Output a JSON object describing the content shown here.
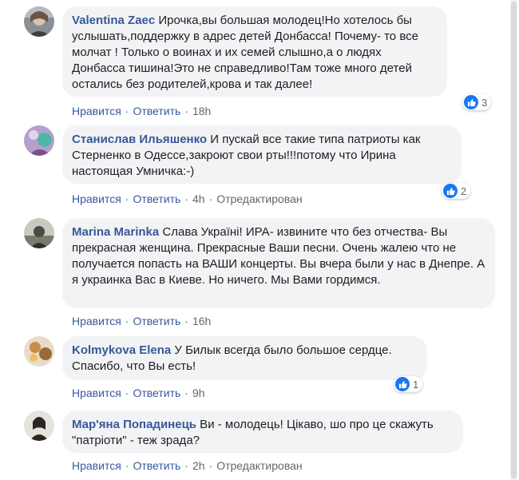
{
  "comments": [
    {
      "author": "Valentina Zaec",
      "text": " Ирочка,вы большая молодец!Но хотелось бы услышать,поддержку в адрес детей Донбасса! Почему- то все молчат ! Только о воинах и их семей слышно,а о людях Донбасса тишина!Это не справедливо!Там тоже много детей остались без родителей,крова и так далее!",
      "like_label": "Нравится",
      "reply_label": "Ответить",
      "time": "18h",
      "edited": "",
      "reactions": "3"
    },
    {
      "author": "Станислав Ильяшенко",
      "text": " И пускай все такие типа патриоты как Стерненко в Одессе,закроют свои рты!!!потому что Ирина настоящая Умничка:-)",
      "like_label": "Нравится",
      "reply_label": "Ответить",
      "time": "4h",
      "edited": "Отредактирован",
      "reactions": "2"
    },
    {
      "author": "Marina Marinka",
      "text": " Слава Україні! ИРА- извините что без отчества- Вы прекрасная женщина. Прекрасные Ваши песни. Очень жалею что не получается попасть на ВАШИ концерты. Вы вчера были у нас в Днепре. А я украинка Вас в Киеве. Но ничего. Мы Вами гордимся.",
      "like_label": "Нравится",
      "reply_label": "Ответить",
      "time": "16h",
      "edited": "",
      "reactions": ""
    },
    {
      "author": "Kolmykova Elena",
      "text": " У Билык всегда было большое сердце. Спасибо, что Вы есть!",
      "like_label": "Нравится",
      "reply_label": "Ответить",
      "time": "9h",
      "edited": "",
      "reactions": "1"
    },
    {
      "author": "Мар'яна Попадинець",
      "text": " Ви - молодець! Цікаво, шо про це скажуть \"патріоти\" - теж зрада?",
      "like_label": "Нравится",
      "reply_label": "Ответить",
      "time": "2h",
      "edited": "Отредактирован",
      "reactions": ""
    }
  ],
  "colors": {
    "link": "#385898",
    "bubble": "#f2f3f5",
    "like_blue": "#1877f2",
    "meta": "#616770"
  },
  "icons": {
    "reaction": "like-thumb-icon"
  }
}
